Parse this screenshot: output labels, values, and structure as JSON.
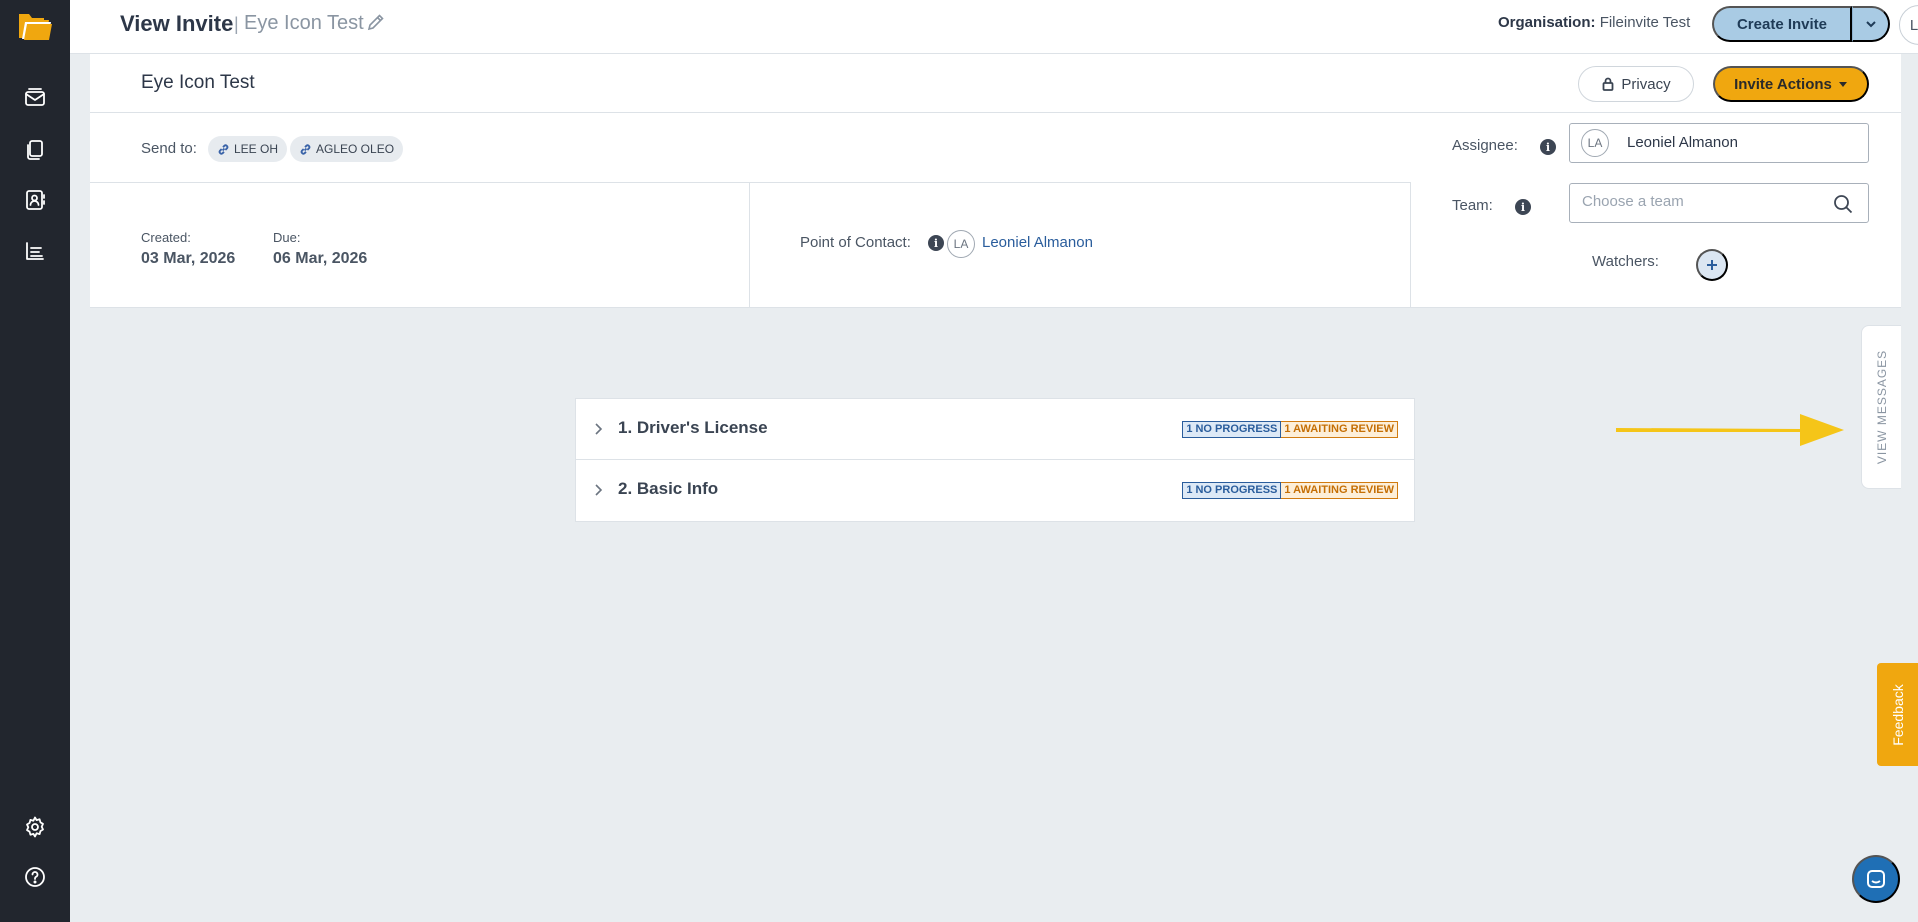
{
  "header": {
    "title": "View Invite",
    "separator": "|",
    "invite_name": "Eye Icon Test",
    "org_label": "Organisation:",
    "org_name": "Fileinvite Test",
    "create_invite": "Create Invite",
    "user_initials": "LA"
  },
  "invite": {
    "title": "Eye Icon Test",
    "privacy_label": "Privacy",
    "actions_label": "Invite Actions"
  },
  "send_to": {
    "label": "Send to:",
    "recipients": [
      "LEE OH",
      "AGLEO OLEO"
    ]
  },
  "dates": {
    "created_label": "Created:",
    "created_value": "03 Mar, 2026",
    "due_label": "Due:",
    "due_value": "06 Mar, 2026"
  },
  "contact": {
    "label": "Point of Contact:",
    "initials": "LA",
    "name": "Leoniel Almanon"
  },
  "assignee": {
    "label": "Assignee:",
    "initials": "LA",
    "name": "Leoniel Almanon"
  },
  "team": {
    "label": "Team:",
    "placeholder": "Choose a team"
  },
  "watchers": {
    "label": "Watchers:"
  },
  "sections": [
    {
      "title": "1. Driver's License",
      "no_progress": "1 NO PROGRESS",
      "awaiting": "1 AWAITING REVIEW"
    },
    {
      "title": "2. Basic Info",
      "no_progress": "1 NO PROGRESS",
      "awaiting": "1 AWAITING REVIEW"
    }
  ],
  "side_tabs": {
    "view_messages": "VIEW MESSAGES",
    "feedback": "Feedback"
  },
  "colors": {
    "sidebar": "#22262e",
    "accent_orange": "#f0a70f",
    "create_blue": "#a9cbe4",
    "link_blue": "#2a5d9c",
    "arrow_yellow": "#f5c518"
  },
  "icons": {
    "sidebar": [
      "folder-logo-icon",
      "mail-icon",
      "documents-icon",
      "contacts-icon",
      "reports-icon",
      "gear-icon",
      "help-icon"
    ]
  }
}
